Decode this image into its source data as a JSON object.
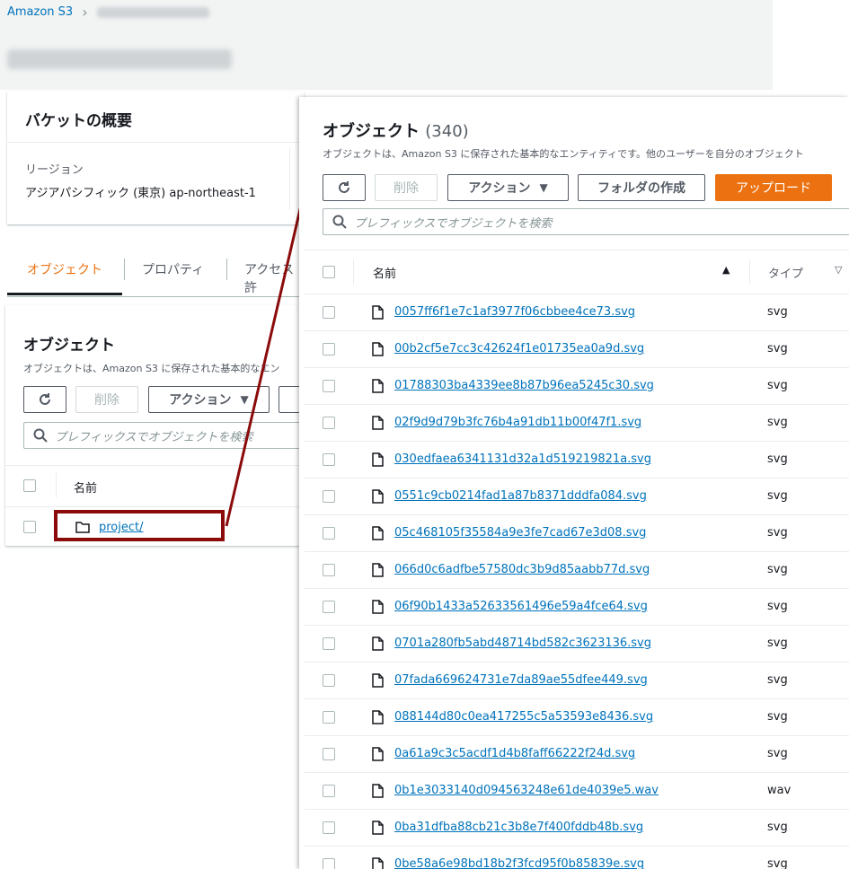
{
  "breadcrumb": {
    "root": "Amazon S3",
    "bucket_redacted": ""
  },
  "overview": {
    "title": "バケットの概要",
    "region_label": "リージョン",
    "region_value": "アジアパシフィック (東京) ap-northeast-1"
  },
  "tabs": [
    "オブジェクト",
    "プロパティ",
    "アクセス許"
  ],
  "objects_small": {
    "title": "オブジェクト",
    "description": "オブジェクトは、Amazon S3 に保存された基本的なエン",
    "refresh_icon": "refresh-icon",
    "delete_label": "削除",
    "actions_label": "アクション",
    "search_placeholder": "プレフィックスでオブジェクトを検索",
    "name_header": "名前",
    "folder_name": "project/"
  },
  "objects_zoom": {
    "title": "オブジェクト",
    "count": "(340)",
    "description": "オブジェクトは、Amazon S3 に保存された基本的なエンティティです。他のユーザーを自分のオブジェクト",
    "delete_label": "削除",
    "actions_label": "アクション",
    "create_folder_label": "フォルダの作成",
    "upload_label": "アップロード",
    "search_placeholder": "プレフィックスでオブジェクトを検索",
    "name_header": "名前",
    "type_header": "タイプ",
    "files": [
      {
        "name": "0057ff6f1e7c1af3977f06cbbee4ce73.svg",
        "type": "svg"
      },
      {
        "name": "00b2cf5e7cc3c42624f1e01735ea0a9d.svg",
        "type": "svg"
      },
      {
        "name": "01788303ba4339ee8b87b96ea5245c30.svg",
        "type": "svg"
      },
      {
        "name": "02f9d9d79b3fc76b4a91db11b00f47f1.svg",
        "type": "svg"
      },
      {
        "name": "030edfaea6341131d32a1d519219821a.svg",
        "type": "svg"
      },
      {
        "name": "0551c9cb0214fad1a87b8371dddfa084.svg",
        "type": "svg"
      },
      {
        "name": "05c468105f35584a9e3fe7cad67e3d08.svg",
        "type": "svg"
      },
      {
        "name": "066d0c6adfbe57580dc3b9d85aabb77d.svg",
        "type": "svg"
      },
      {
        "name": "06f90b1433a52633561496e59a4fce64.svg",
        "type": "svg"
      },
      {
        "name": "0701a280fb5abd48714bd582c3623136.svg",
        "type": "svg"
      },
      {
        "name": "07fada669624731e7da89ae55dfee449.svg",
        "type": "svg"
      },
      {
        "name": "088144d80c0ea417255c5a53593e8436.svg",
        "type": "svg"
      },
      {
        "name": "0a61a9c3c5acdf1d4b8faff66222f24d.svg",
        "type": "svg"
      },
      {
        "name": "0b1e3033140d094563248e61de4039e5.wav",
        "type": "wav"
      },
      {
        "name": "0ba31dfba88cb21c3b8e7f400fddb48b.svg",
        "type": "svg"
      },
      {
        "name": "0be58a6e98bd18b2f3fcd95f0b85839e.svg",
        "type": "svg"
      }
    ]
  }
}
